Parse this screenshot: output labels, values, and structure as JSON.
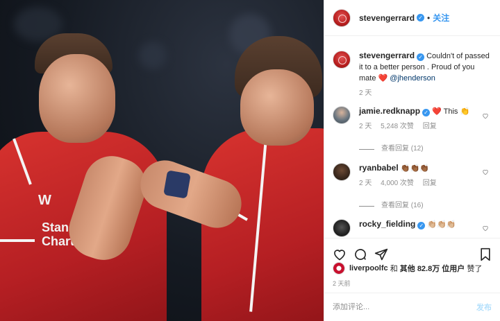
{
  "post": {
    "username": "stevengerrard",
    "follow_label": "关注",
    "dot": "•"
  },
  "caption": {
    "username": "stevengerrard",
    "text": "Couldn't of passed it to a better person . Proud of you mate",
    "emoji": "❤️",
    "mention": "@jhenderson",
    "time": "2 天"
  },
  "comments": [
    {
      "username": "jamie.redknapp",
      "text": "❤️ This 👏",
      "time": "2 天",
      "likes": "5,248 次赞",
      "reply_label": "回复",
      "view_replies": "查看回复 (12)"
    },
    {
      "username": "ryanbabel",
      "text": "👏🏾👏🏾👏🏾",
      "time": "2 天",
      "likes": "4,000 次赞",
      "reply_label": "回复",
      "view_replies": "查看回复 (16)"
    },
    {
      "username": "rocky_fielding",
      "text": "👏🏼👏🏼👏🏼",
      "time": "",
      "likes": "",
      "reply_label": "",
      "view_replies": ""
    }
  ],
  "likes_line": {
    "liker": "liverpoolfc",
    "and": "和",
    "others": "其他",
    "count": "82.8万",
    "users": "位用户",
    "liked": "赞了"
  },
  "timestamp": "2 天前",
  "add_comment": {
    "placeholder": "添加评论...",
    "post_label": "发布"
  },
  "photo": {
    "shirt_text": "Standard Chartered",
    "kit_logo": "W"
  },
  "colors": {
    "accent": "#3897f0",
    "heart": "#ed4956",
    "shirt_red": "#c8102e"
  },
  "icons": [
    "verified-badge-icon",
    "heart-icon",
    "comment-icon",
    "share-icon",
    "bookmark-icon"
  ]
}
